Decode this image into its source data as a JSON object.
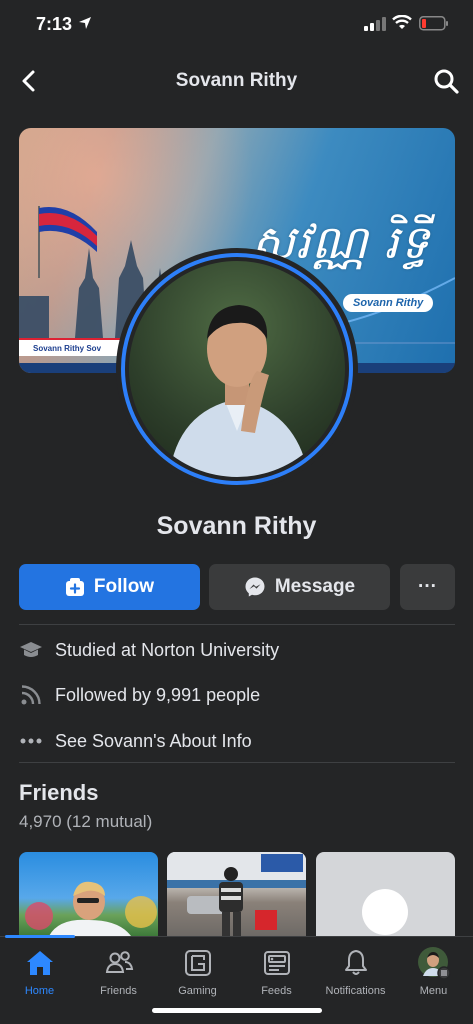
{
  "status_bar": {
    "time": "7:13"
  },
  "nav": {
    "title": "Sovann Rithy"
  },
  "cover": {
    "khmer_title": "សុវណ្ណ រិទ្ធី",
    "name_tag": "Sovann Rithy",
    "strip_text": "Sovann Rithy  Sov"
  },
  "profile": {
    "name": "Sovann Rithy"
  },
  "actions": {
    "follow_label": "Follow",
    "message_label": "Message",
    "more_label": "···"
  },
  "info": {
    "education": "Studied at Norton University",
    "followers": "Followed by 9,991 people",
    "about": "See Sovann's About Info"
  },
  "friends": {
    "title": "Friends",
    "count": "4,970 (12 mutual)"
  },
  "tabs": [
    {
      "label": "Home",
      "icon": "home-icon",
      "active": true
    },
    {
      "label": "Friends",
      "icon": "friends-icon"
    },
    {
      "label": "Gaming",
      "icon": "gaming-icon"
    },
    {
      "label": "Feeds",
      "icon": "feeds-icon"
    },
    {
      "label": "Notifications",
      "icon": "bell-icon"
    },
    {
      "label": "Menu",
      "icon": "menu-avatar-icon"
    }
  ],
  "colors": {
    "background": "#242526",
    "accent": "#2374e1",
    "secondary_button": "#3a3b3c",
    "text": "#e4e6eb",
    "muted_text": "#b0b3b8"
  }
}
